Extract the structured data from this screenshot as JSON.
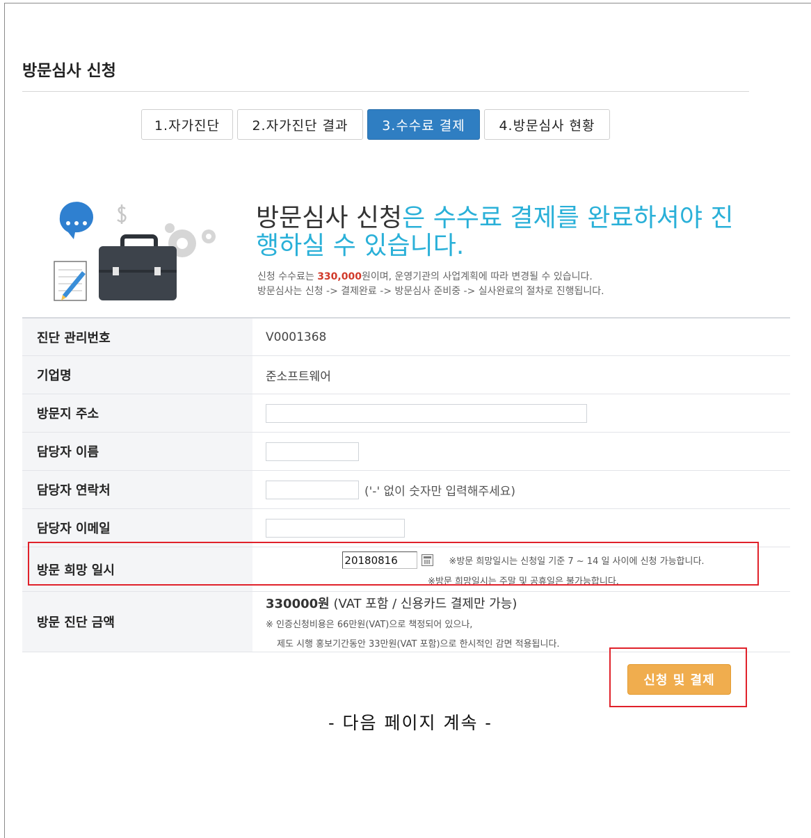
{
  "page": {
    "title": "방문심사 신청"
  },
  "steps": [
    {
      "label": "1.자가진단",
      "active": false
    },
    {
      "label": "2.자가진단 결과",
      "active": false
    },
    {
      "label": "3.수수료 결제",
      "active": true
    },
    {
      "label": "4.방문심사 현황",
      "active": false
    }
  ],
  "intro": {
    "headline_dark": "방문심사 신청",
    "headline_light": "은 수수료 결제를 완료하셔야 진행하실 수 있습니다.",
    "note1_prefix": "신청 수수료는 ",
    "note1_fee": "330,000",
    "note1_suffix": "원이며, 운영기관의 사업계획에 따라 변경될 수 있습니다.",
    "note2": "방문심사는 신청 -> 결제완료 -> 방문심사 준비중 -> 실사완료의 절차로 진행됩니다."
  },
  "form": {
    "mgmt_no": {
      "label": "진단 관리번호",
      "value": "V0001368"
    },
    "company": {
      "label": "기업명",
      "value": "준소프트웨어"
    },
    "address": {
      "label": "방문지 주소",
      "value": ""
    },
    "contact_name": {
      "label": "담당자 이름",
      "value": ""
    },
    "contact_phone": {
      "label": "담당자 연락처",
      "value": "",
      "hint": "('-' 없이 숫자만 입력해주세요)"
    },
    "contact_email": {
      "label": "담당자 이메일",
      "value": ""
    },
    "visit_date": {
      "label": "방문 희망 일시",
      "value": "20180816",
      "note1": "※방문 희망일시는 신청일 기준 7 ~ 14 일 사이에 신청 가능합니다.",
      "note2": "※방문 희망일시는 주말 및 공휴일은 불가능합니다."
    },
    "visit_amount": {
      "label": "방문 진단 금액",
      "amount": "330000원",
      "amount_note": " (VAT 포함 / 신용카드 결제만 가능)",
      "note1": "※ 인증신청비용은 66만원(VAT)으로 책정되어 있으나,",
      "note2": "제도 시행 홍보기간동안 33만원(VAT 포함)으로 한시적인 감면 적용됩니다."
    }
  },
  "actions": {
    "submit_label": "신청 및 결제"
  },
  "footer": {
    "continue_text": "- 다음 페이지 계속 -"
  },
  "colors": {
    "accent": "#2f7ec2",
    "highlight": "#2ab0d8",
    "fee": "#d13a2a",
    "button": "#f0ad4e",
    "annotation": "#e0212a"
  }
}
